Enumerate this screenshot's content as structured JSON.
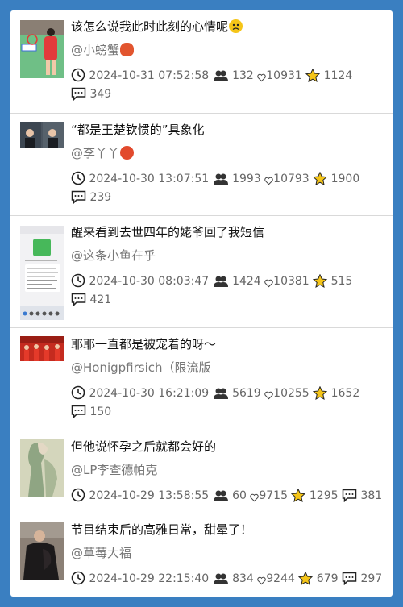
{
  "colors": {
    "background": "#3a7fc1",
    "card": "#ffffff",
    "divider": "#d9d9d9",
    "meta_text": "#666666",
    "author_text": "#777777",
    "star": "#f5c518"
  },
  "posts": [
    {
      "title": "该怎么说我此时此刻的心情呢",
      "title_emoji": "worried-face-emoji",
      "author": "@小螃蟹",
      "author_emoji": "crab-emoji",
      "time": "2024-10-31 07:52:58",
      "views": "132",
      "likes": "10931",
      "stars": "1124",
      "comments": "349"
    },
    {
      "title": "“都是王楚钦惯的”具象化",
      "author": "@李丫丫",
      "author_emoji": "speech-balloon-emoji",
      "time": "2024-10-30 13:07:51",
      "views": "1993",
      "likes": "10793",
      "stars": "1900",
      "comments": "239"
    },
    {
      "title": "醒来看到去世四年的姥爷回了我短信",
      "author": "@这条小鱼在乎",
      "time": "2024-10-30 08:03:47",
      "views": "1424",
      "likes": "10381",
      "stars": "515",
      "comments": "421"
    },
    {
      "title": "耶耶一直都是被宠着的呀～",
      "author": "@Honigpfirsich（限流版",
      "time": "2024-10-30 16:21:09",
      "views": "5619",
      "likes": "10255",
      "stars": "1652",
      "comments": "150"
    },
    {
      "title": "但他说怀孕之后就都会好的",
      "author": "@LP李查德帕克",
      "time": "2024-10-29 13:58:55",
      "views": "60",
      "likes": "9715",
      "stars": "1295",
      "comments": "381"
    },
    {
      "title": "节目结束后的高雅日常，甜晕了！",
      "author": "@草莓大福",
      "time": "2024-10-29 22:15:40",
      "views": "834",
      "likes": "9244",
      "stars": "679",
      "comments": "297"
    }
  ]
}
